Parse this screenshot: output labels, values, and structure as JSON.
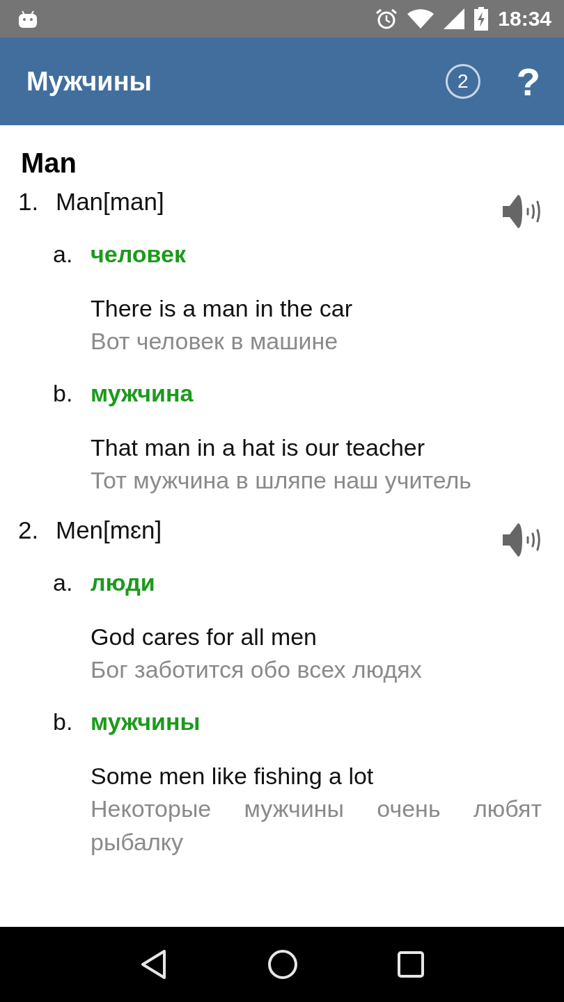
{
  "status_bar": {
    "time": "18:34"
  },
  "toolbar": {
    "title": "Мужчины",
    "counter": "2",
    "help": "?"
  },
  "headword": "Man",
  "entries": [
    {
      "number": "1.",
      "word": "Man",
      "transcription": "[man]",
      "senses": [
        {
          "letter": "a.",
          "translation": "человек",
          "example": "There is a man in the car",
          "example_translation": "Вот человек в машине"
        },
        {
          "letter": "b.",
          "translation": "мужчина",
          "example": "That man in a hat is our teacher",
          "example_translation": "Тот мужчина в шляпе наш учитель"
        }
      ]
    },
    {
      "number": "2.",
      "word": "Men",
      "transcription": "[mɛn]",
      "senses": [
        {
          "letter": "a.",
          "translation": "люди",
          "example": "God cares for all men",
          "example_translation": "Бог заботится обо всех людях"
        },
        {
          "letter": "b.",
          "translation": "мужчины",
          "example": "Some men like fishing a lot",
          "example_translation": "Некоторые мужчины очень любят рыбалку"
        }
      ]
    }
  ]
}
